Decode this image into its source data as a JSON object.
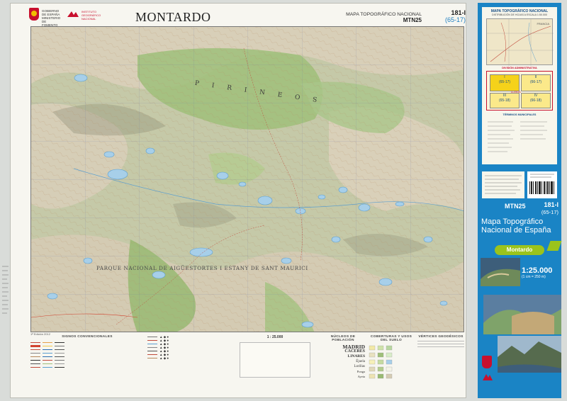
{
  "header": {
    "ministry": "GOBIERNO DE ESPAÑA",
    "ministry_sub": "MINISTERIO DE FOMENTO",
    "agency": "INSTITUTO GEOGRÁFICO NACIONAL",
    "title": "MONTARDO",
    "series": "MAPA TOPOGRÁFICO NACIONAL",
    "series_code": "MTN25",
    "sheet_number": "181-I",
    "sheet_grid": "(65-17)"
  },
  "map": {
    "labels": [
      "PIRINEOS",
      "PARQUE NACIONAL DE AIGÜESTORTES I ESTANY DE SANT MAURICI"
    ],
    "lake_color": "#a7cfe9",
    "forest_color": "#9fbf7a",
    "rock_color": "#d8cfb8"
  },
  "legend": {
    "signos_title": "SIGNOS CONVENCIONALES",
    "scale": "1 : 25.000",
    "nucleos_title": "NÚCLEOS DE POBLACIÓN",
    "cobertura_title": "COBERTURAS Y USOS DEL SUELO",
    "vertices_title": "VÉRTICES GEODÉSICOS",
    "cities": [
      "MADRID",
      "CÁCERES",
      "LINARES",
      "Éjuela",
      "Lorillas",
      "Ponga",
      "Ayeta"
    ],
    "date": "1ª Edición 2012"
  },
  "cover": {
    "index_title": "MAPA TOPOGRÁFICO NACIONAL",
    "index_sub": "DISTRIBUCIÓN DE HOJAS A ESCALA 1:50.000",
    "country": "FRANCIA",
    "admin_title": "DIVISIÓN ADMINISTRATIVA",
    "municipios_title": "TÉRMINOS MUNICIPALES",
    "region": "LLEIDA",
    "quadrants": [
      {
        "num": "I",
        "grid": "(65-17)"
      },
      {
        "num": "II",
        "grid": "(66-17)"
      },
      {
        "num": "III",
        "grid": "(65-18)"
      },
      {
        "num": "IV",
        "grid": "(66-18)"
      }
    ],
    "series_code": "MTN25",
    "sheet_number": "181-I",
    "sheet_grid": "(65-17)",
    "product": "Mapa Topográfico Nacional de España",
    "sheet_name": "Montardo",
    "scale": "1:25.000",
    "scale_sub": "(1 cm = 250 m)"
  },
  "colors": {
    "cover_blue": "#1a84c5",
    "pill_green": "#9bc31c",
    "index_yellow": "#f5d21a"
  }
}
